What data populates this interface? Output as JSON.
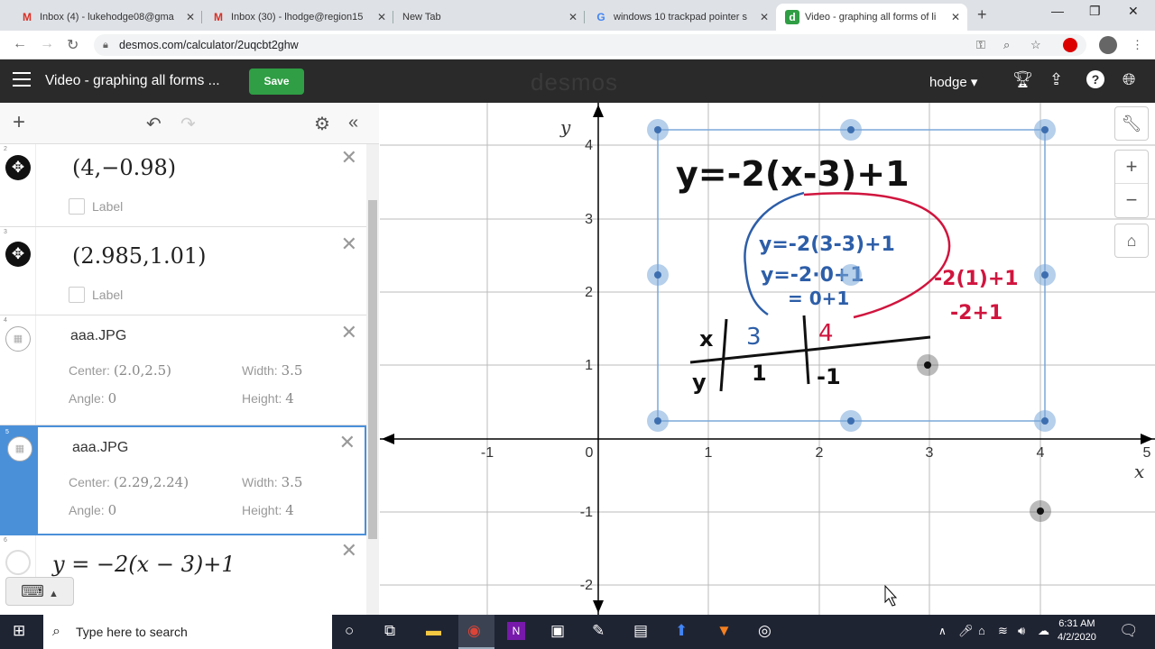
{
  "browser": {
    "tabs": [
      {
        "label": "Inbox (4) - lukehodge08@gma",
        "icon": "M",
        "icon_color": "#d93025"
      },
      {
        "label": "Inbox (30) - lhodge@region15",
        "icon": "M",
        "icon_color": "#d93025"
      },
      {
        "label": "New Tab",
        "icon": "",
        "icon_color": "#888"
      },
      {
        "label": "windows 10 trackpad pointer s",
        "icon": "G",
        "icon_color": "#4285f4"
      },
      {
        "label": "Video - graphing all forms of li",
        "icon": "d",
        "icon_color": "#2f9e44"
      }
    ],
    "url": "desmos.com/calculator/2uqcbt2ghw"
  },
  "app": {
    "title": "Video - graphing all forms ...",
    "save_label": "Save",
    "logo": "desmos",
    "user": "hodge"
  },
  "expressions": [
    {
      "num": "2",
      "latex": "(4,−0.98)",
      "label": "Label"
    },
    {
      "num": "3",
      "latex": "(2.985,1.01)",
      "label": "Label"
    },
    {
      "num": "4",
      "name": "aaa.JPG",
      "center_label": "Center:",
      "center": "(2.0,2.5)",
      "width_label": "Width:",
      "width": "3.5",
      "angle_label": "Angle:",
      "angle": "0",
      "height_label": "Height:",
      "height": "4"
    },
    {
      "num": "5",
      "name": "aaa.JPG",
      "center_label": "Center:",
      "center": "(2.29,2.24)",
      "width_label": "Width:",
      "width": "3.5",
      "angle_label": "Angle:",
      "angle": "0",
      "height_label": "Height:",
      "height": "4"
    },
    {
      "num": "6",
      "latex": "y = −2(x − 3)+1"
    }
  ],
  "graph": {
    "x_label": "x",
    "y_label": "y",
    "x_ticks": [
      "-1",
      "0",
      "1",
      "2",
      "3",
      "4",
      "5"
    ],
    "y_ticks": [
      "4",
      "3",
      "2",
      "1",
      "-1",
      "-2"
    ],
    "points": [
      {
        "x": 4,
        "y": -0.98
      },
      {
        "x": 2.985,
        "y": 1.01
      }
    ],
    "handwriting": {
      "equation": "y=-2(x-3)+1",
      "sub1": "y=-2(3-3)+1",
      "sub2": "y=-2·0+1",
      "sub3": "= 0+1",
      "red1": "-2(1)+1",
      "red2": "-2+1",
      "table_x": "x",
      "table_y": "y",
      "x_vals": [
        "3",
        "4"
      ],
      "y_vals": [
        "1",
        "-1"
      ]
    }
  },
  "taskbar": {
    "search_placeholder": "Type here to search",
    "time": "6:31 AM",
    "date": "4/2/2020"
  },
  "colors": {
    "save": "#2f9e44",
    "appbar": "#2a2a2a",
    "selected": "#4a90d9"
  }
}
